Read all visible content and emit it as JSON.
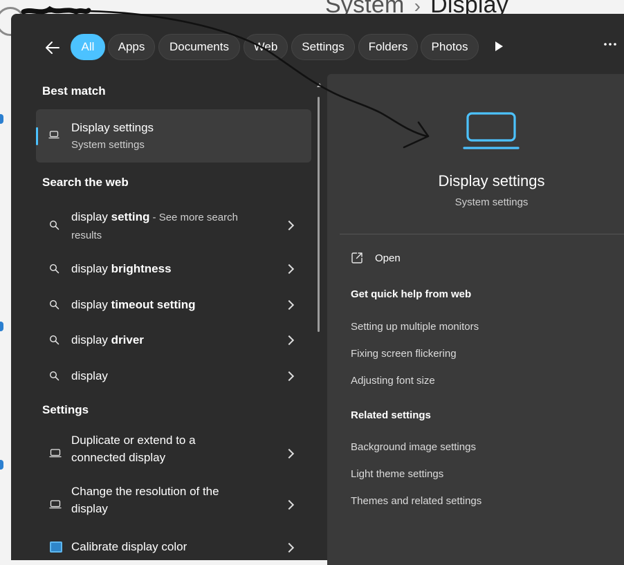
{
  "background_window": {
    "breadcrumb_parent": "System",
    "breadcrumb_separator": "›",
    "breadcrumb_current": "Display"
  },
  "filters": {
    "tabs": [
      "All",
      "Apps",
      "Documents",
      "Web",
      "Settings",
      "Folders",
      "Photos"
    ],
    "active": "All"
  },
  "left": {
    "best_match_heading": "Best match",
    "best_match": {
      "title": "Display settings",
      "subtitle": "System settings"
    },
    "web_heading": "Search the web",
    "web_results": [
      {
        "prefix": "display ",
        "bold": "setting",
        "suffix": " - See more search results"
      },
      {
        "prefix": "display ",
        "bold": "brightness",
        "suffix": ""
      },
      {
        "prefix": "display ",
        "bold": "timeout setting",
        "suffix": ""
      },
      {
        "prefix": "display ",
        "bold": "driver",
        "suffix": ""
      },
      {
        "prefix": "display",
        "bold": "",
        "suffix": ""
      }
    ],
    "settings_heading": "Settings",
    "settings_results": [
      "Duplicate or extend to a connected display",
      "Change the resolution of the display",
      "Calibrate display color"
    ]
  },
  "right": {
    "title": "Display settings",
    "subtitle": "System settings",
    "open_label": "Open",
    "quick_help_heading": "Get quick help from web",
    "quick_help_links": [
      "Setting up multiple monitors",
      "Fixing screen flickering",
      "Adjusting font size"
    ],
    "related_heading": "Related settings",
    "related_links": [
      "Background image settings",
      "Light theme settings",
      "Themes and related settings"
    ]
  },
  "colors": {
    "accent": "#4cc2ff",
    "panel": "#2c2c2c",
    "preview": "#3a3a3a"
  },
  "icons": {
    "laptop": "laptop-icon",
    "search": "search-icon",
    "open": "open-external-icon",
    "back": "back-arrow-icon",
    "more": "more-icon",
    "play": "play-icon"
  }
}
